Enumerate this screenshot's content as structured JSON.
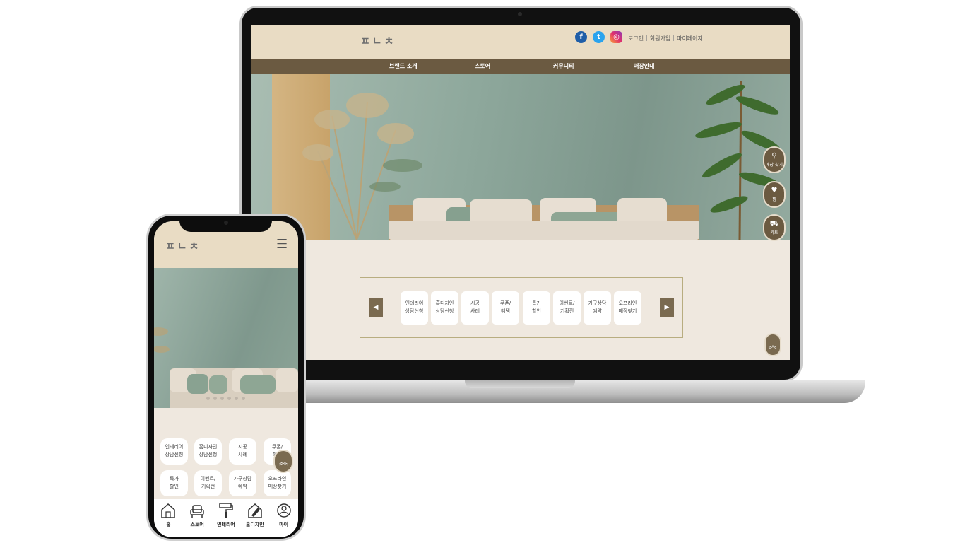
{
  "site": {
    "logo": "ㅍㄴㅊ",
    "utility": [
      "로그인",
      "회원가입",
      "마이페이지"
    ],
    "nav": [
      "브랜드 소개",
      "스토어",
      "커뮤니티",
      "매장안내"
    ],
    "side_buttons": [
      {
        "icon": "map-pin-icon",
        "label": "매장 찾기"
      },
      {
        "icon": "heart-icon",
        "label": "찜"
      },
      {
        "icon": "cart-icon",
        "label": "카트"
      }
    ],
    "carousel_items": [
      "인테리어\n상담신청",
      "홈디자인\n상담신청",
      "시공\n사례",
      "쿠폰/\n혜택",
      "특가\n할인",
      "이벤트/\n기획전",
      "가구상담\n예약",
      "오프라인\n매장찾기"
    ]
  },
  "mobile": {
    "logo": "ㅍㄴㅊ",
    "grid_items": [
      "인테리어\n상담신청",
      "홈디자인\n상담신청",
      "시공\n사례",
      "쿠폰/\n혜택",
      "특가\n할인",
      "이벤트/\n기획전",
      "가구상담\n예약",
      "오프라인\n매장찾기"
    ],
    "tabs": [
      "홈",
      "스토어",
      "인테리어",
      "홈디자인",
      "마이"
    ]
  },
  "colors": {
    "header_beige": "#e9dcc4",
    "nav_brown": "#6b5a41",
    "page_bg": "#efe8df",
    "accent_brown": "#7a6a50"
  }
}
